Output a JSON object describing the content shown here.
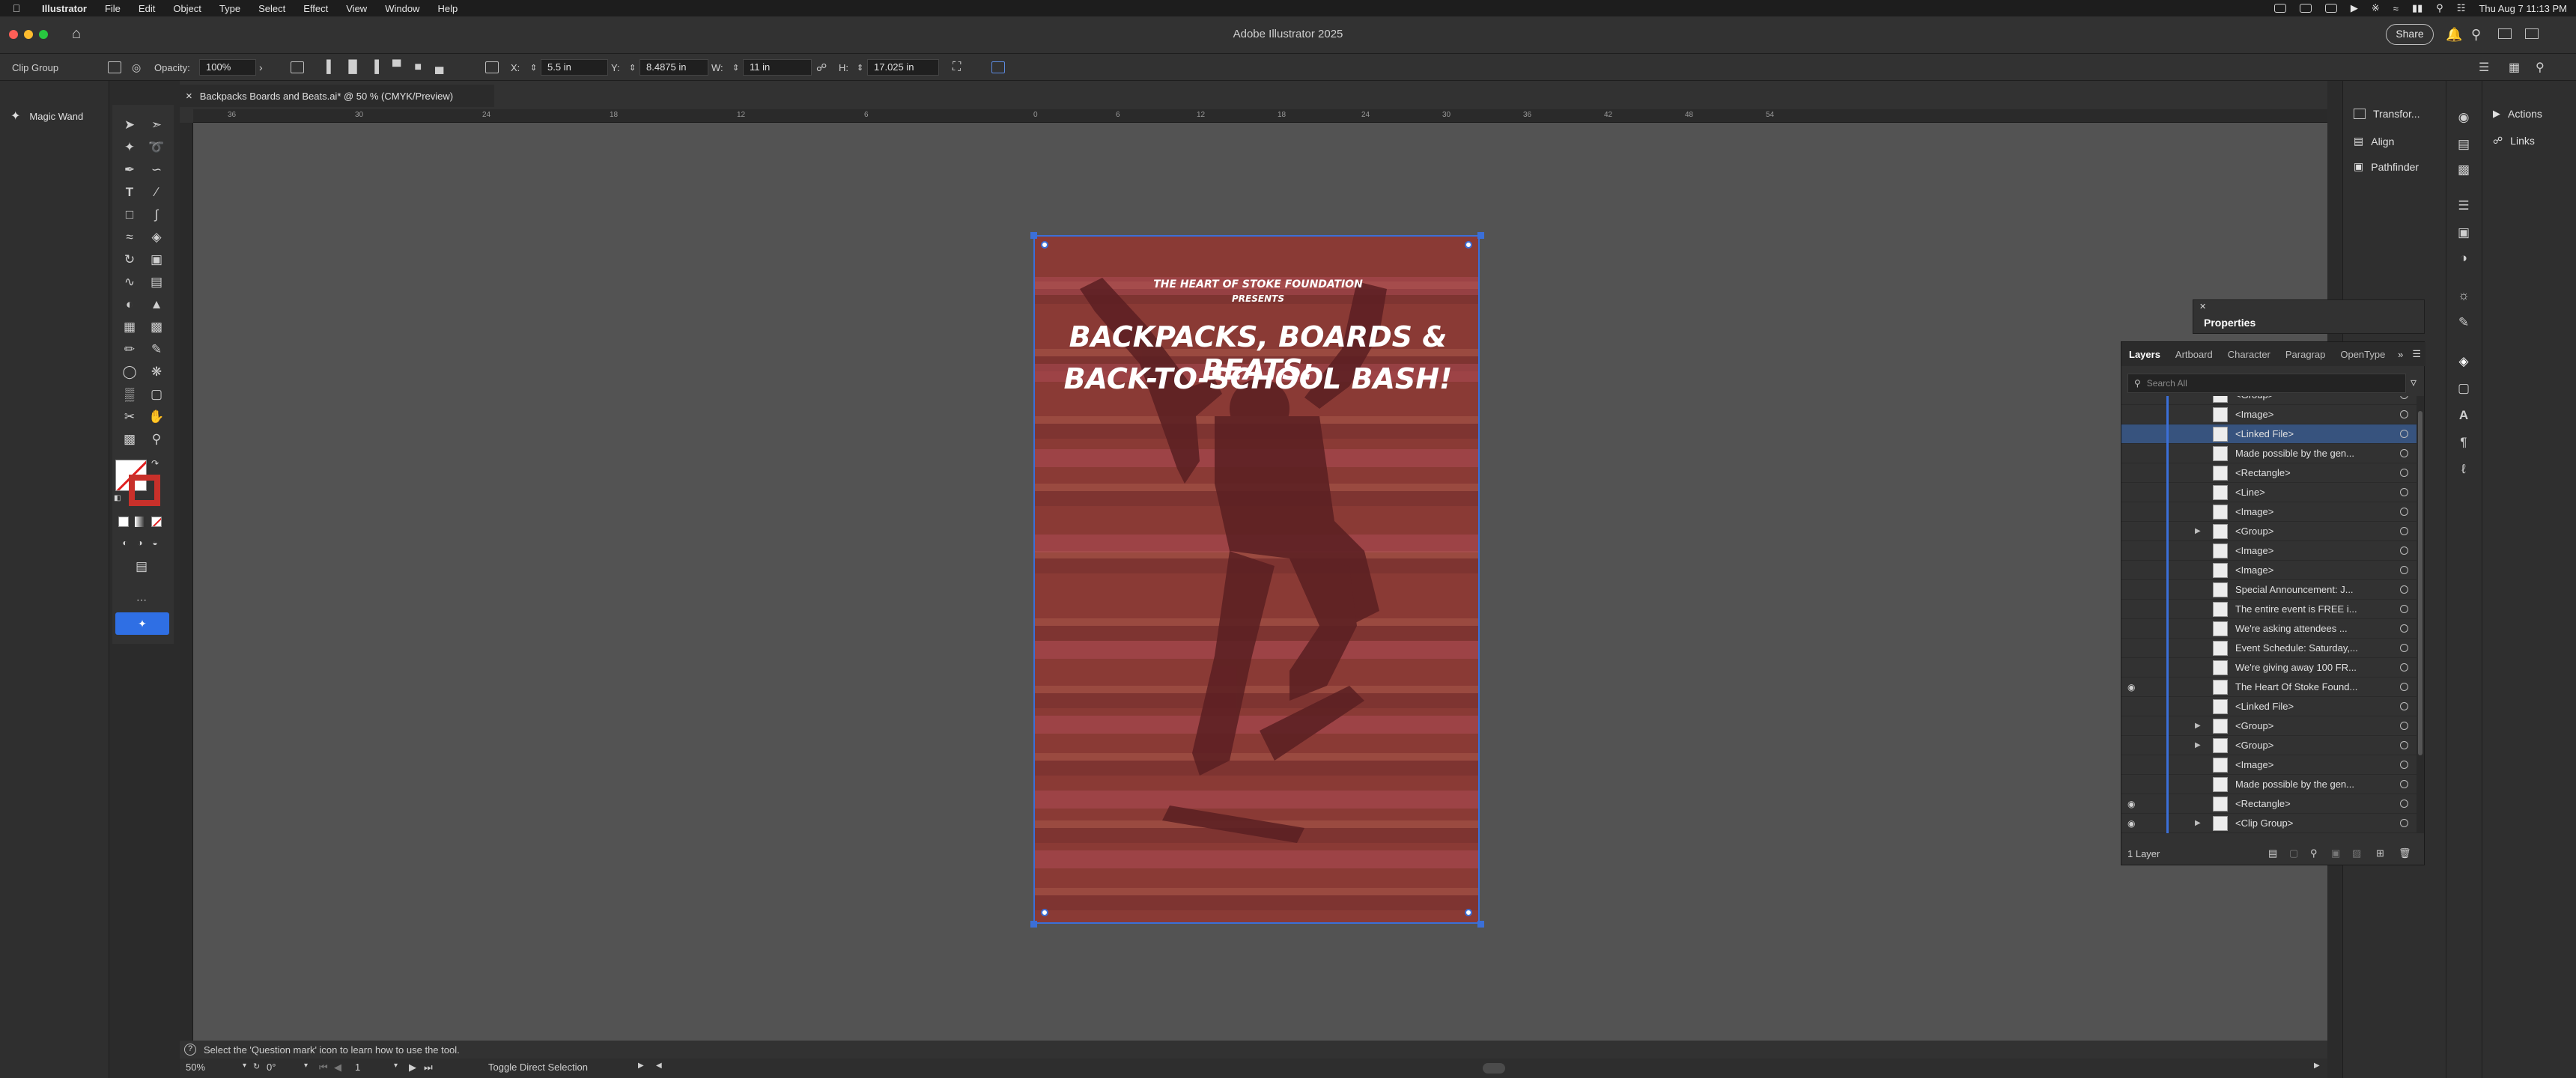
{
  "menubar": {
    "apple": "",
    "items": [
      "Illustrator",
      "File",
      "Edit",
      "Object",
      "Type",
      "Select",
      "Effect",
      "View",
      "Window",
      "Help"
    ],
    "clock": "Thu Aug 7  11:13 PM"
  },
  "window": {
    "title": "Adobe Illustrator 2025",
    "share_label": "Share"
  },
  "controlbar": {
    "selection_type": "Clip Group",
    "opacity_label": "Opacity:",
    "opacity_value": "100%",
    "x_label": "X:",
    "x_value": "5.5 in",
    "y_label": "Y:",
    "y_value": "8.4875 in",
    "w_label": "W:",
    "w_value": "11 in",
    "h_label": "H:",
    "h_value": "17.025 in"
  },
  "tool_tip": {
    "label": "Magic Wand"
  },
  "document": {
    "tab_title": "Backpacks Boards and Beats.ai* @ 50 % (CMYK/Preview)",
    "close_glyph": "×",
    "ruler_ticks": [
      "36",
      "30",
      "24",
      "18",
      "12",
      "6",
      "0",
      "6",
      "12",
      "18",
      "24",
      "30",
      "36",
      "42",
      "48",
      "54"
    ]
  },
  "artboard": {
    "presenter_line1": "THE HEART OF STOKE FOUNDATION",
    "presenter_line2": "PRESENTS",
    "headline_line1": "BACKPACKS, BOARDS & BEATS:",
    "headline_line2": "BACK-TO-SCHOOL BASH!"
  },
  "statusbar": {
    "message": "Select the 'Question mark' icon to learn how to use the tool."
  },
  "footer": {
    "zoom": "50%",
    "rotation": "0°",
    "artboard_num": "1",
    "tool_state": "Toggle Direct Selection"
  },
  "right_panels": {
    "transform": "Transfor...",
    "align": "Align",
    "pathfinder": "Pathfinder",
    "actions": "Actions",
    "links": "Links"
  },
  "properties_tab": {
    "label": "Properties"
  },
  "layers": {
    "tabs": [
      "Layers",
      "Artboard",
      "Character",
      "Paragrap",
      "OpenType"
    ],
    "search_placeholder": "Search All",
    "rows": [
      {
        "name": "<Group>",
        "sel": false
      },
      {
        "name": "<Image>",
        "sel": false
      },
      {
        "name": "<Linked File>",
        "sel": true
      },
      {
        "name": "Made possible by the gen...",
        "sel": false
      },
      {
        "name": "<Rectangle>",
        "sel": false
      },
      {
        "name": "<Line>",
        "sel": false
      },
      {
        "name": "<Image>",
        "sel": false
      },
      {
        "name": "<Group>",
        "sel": false
      },
      {
        "name": "<Image>",
        "sel": false
      },
      {
        "name": "<Image>",
        "sel": false
      },
      {
        "name": "Special Announcement: J...",
        "sel": false
      },
      {
        "name": "The entire event is FREE i...",
        "sel": false
      },
      {
        "name": "We're asking attendees ...",
        "sel": false
      },
      {
        "name": "Event Schedule: Saturday,...",
        "sel": false
      },
      {
        "name": "We're giving away 100 FR...",
        "sel": false
      },
      {
        "name": "The Heart Of Stoke Found...",
        "sel": false
      },
      {
        "name": "<Linked File>",
        "sel": false
      },
      {
        "name": "<Group>",
        "sel": false
      },
      {
        "name": "<Group>",
        "sel": false
      },
      {
        "name": "<Image>",
        "sel": false
      },
      {
        "name": "Made possible by the gen...",
        "sel": false
      },
      {
        "name": "<Rectangle>",
        "sel": false
      },
      {
        "name": "<Clip Group>",
        "sel": false
      }
    ],
    "layer_count": "1 Layer"
  }
}
